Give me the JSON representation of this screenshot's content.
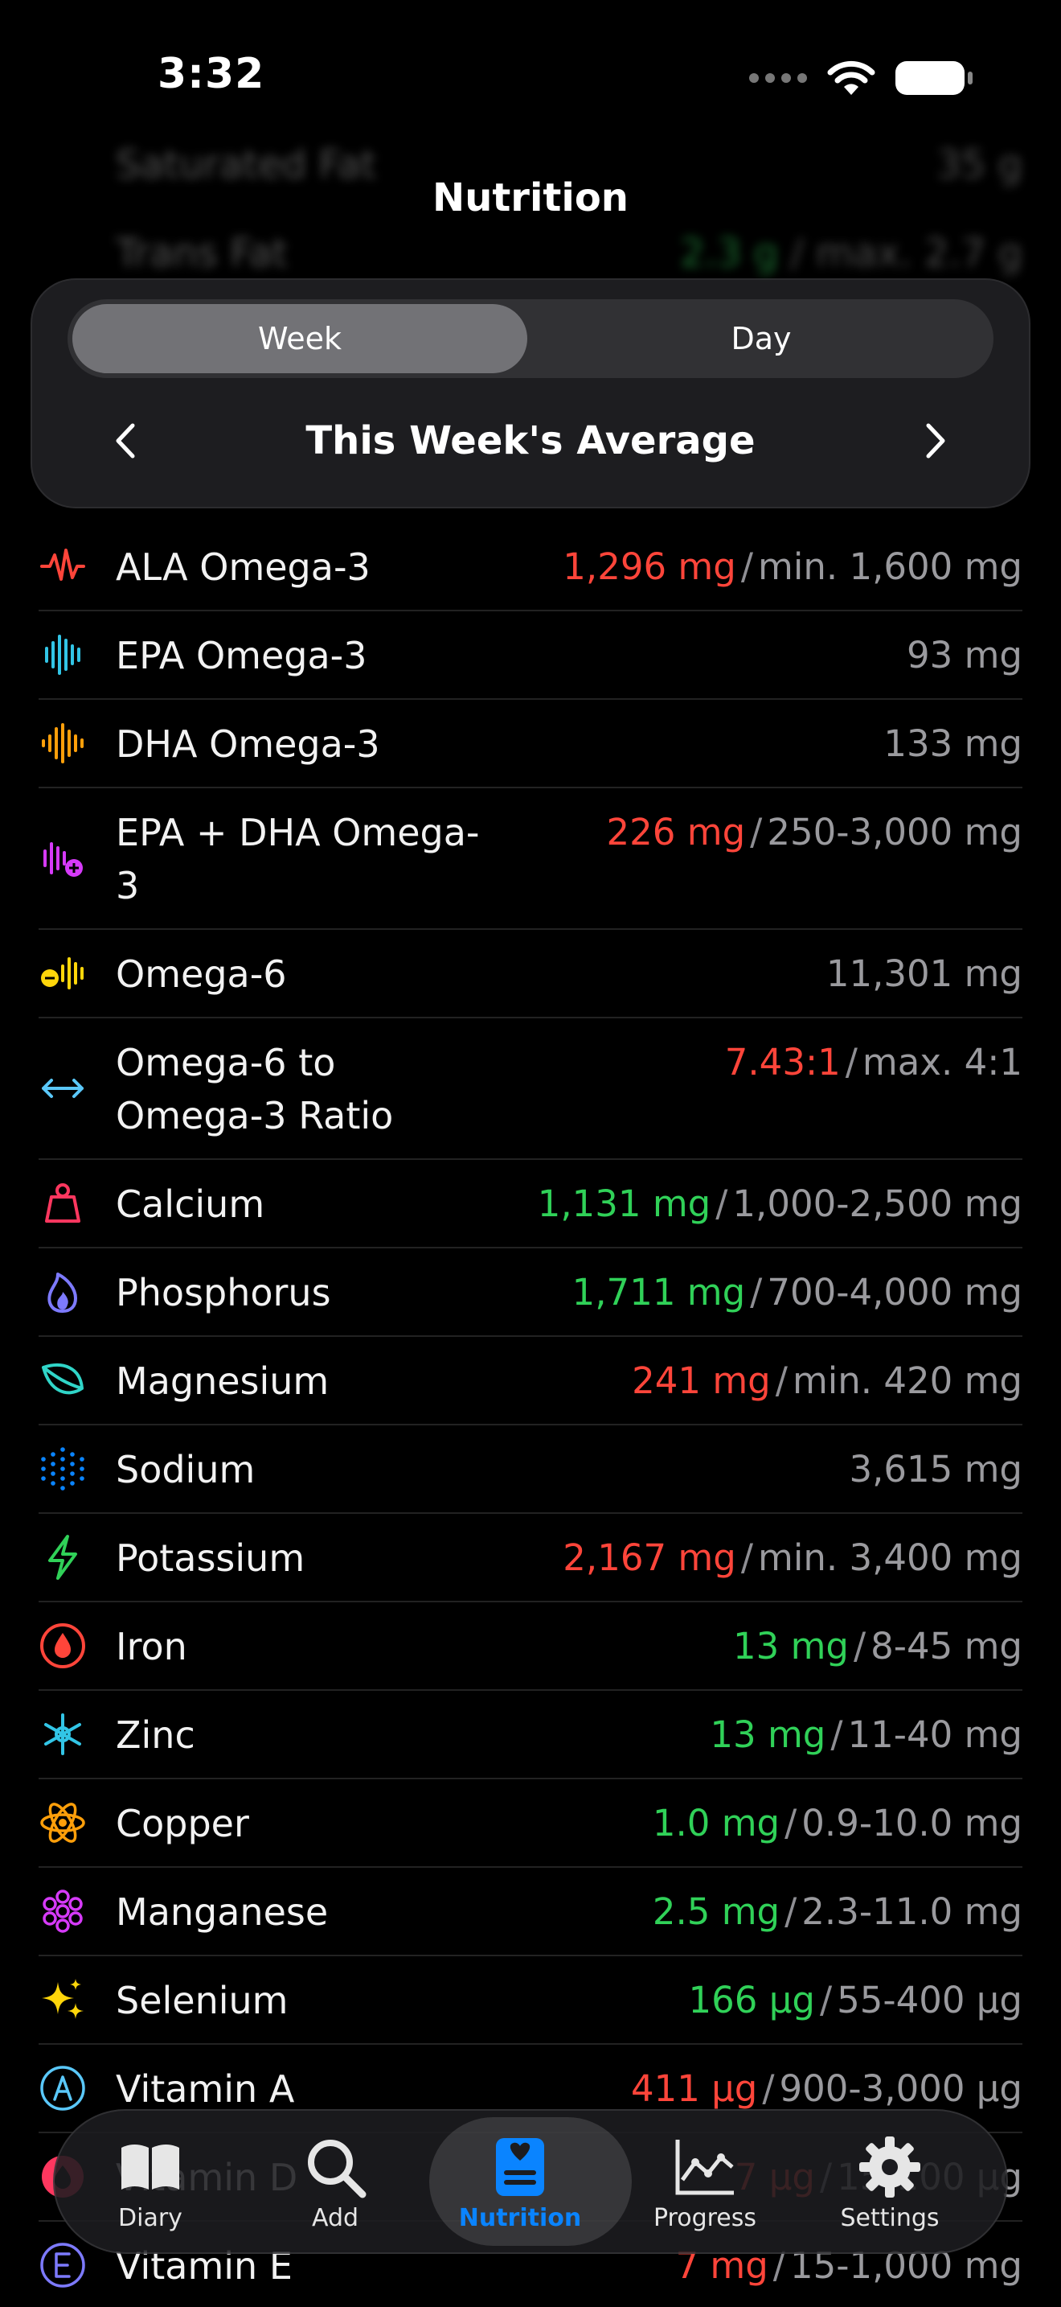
{
  "status_bar": {
    "time": "3:32"
  },
  "title": "Nutrition",
  "segmented_control": {
    "week_label": "Week",
    "day_label": "Day",
    "selected": "Week"
  },
  "period_label": "This Week's Average",
  "ghost_rows": [
    {
      "name": "Saturated Fat",
      "value": "35 g"
    },
    {
      "name": "Trans Fat",
      "value_amount": "2.3 g",
      "value_target": "max. 2.7 g"
    }
  ],
  "nutrients": [
    {
      "name": "ALA Omega-3",
      "amount": "1,296 mg",
      "status": "red",
      "target": "min. 1,600 mg",
      "icon": "ala-waveform-icon",
      "color": "#ff453a"
    },
    {
      "name": "EPA Omega-3",
      "amount": "93 mg",
      "status": "neutral",
      "target": "",
      "icon": "epa-waveform-icon",
      "color": "#32c5e6"
    },
    {
      "name": "DHA Omega-3",
      "amount": "133 mg",
      "status": "neutral",
      "target": "",
      "icon": "dha-waveform-icon",
      "color": "#ff9f0a"
    },
    {
      "name": "EPA + DHA Omega-3",
      "amount": "226 mg",
      "status": "red",
      "target": "250-3,000 mg",
      "icon": "epa-dha-waveform-plus-icon",
      "color": "#d63af9"
    },
    {
      "name": "Omega-6",
      "amount": "11,301 mg",
      "status": "neutral",
      "target": "",
      "icon": "omega6-waveform-minus-icon",
      "color": "#ffd60a"
    },
    {
      "name": "Omega-6 to Omega-3 Ratio",
      "amount": "7.43:1",
      "status": "red",
      "target": "max. 4:1",
      "icon": "left-right-arrow-icon",
      "color": "#5ac8fa"
    },
    {
      "name": "Calcium",
      "amount": "1,131 mg",
      "status": "green",
      "target": "1,000-2,500 mg",
      "icon": "weight-icon",
      "color": "#ff375f"
    },
    {
      "name": "Phosphorus",
      "amount": "1,711 mg",
      "status": "green",
      "target": "700-4,000 mg",
      "icon": "flame-icon",
      "color": "#7d7aff"
    },
    {
      "name": "Magnesium",
      "amount": "241 mg",
      "status": "red",
      "target": "min. 420 mg",
      "icon": "leaf-icon",
      "color": "#30d5c8"
    },
    {
      "name": "Sodium",
      "amount": "3,615 mg",
      "status": "neutral",
      "target": "",
      "icon": "dots-circle-icon",
      "color": "#0a84ff"
    },
    {
      "name": "Potassium",
      "amount": "2,167 mg",
      "status": "red",
      "target": "min. 3,400 mg",
      "icon": "bolt-icon",
      "color": "#30d158"
    },
    {
      "name": "Iron",
      "amount": "13 mg",
      "status": "green",
      "target": "8-45 mg",
      "icon": "drop-circle-icon",
      "color": "#ff453a"
    },
    {
      "name": "Zinc",
      "amount": "13 mg",
      "status": "green",
      "target": "11-40 mg",
      "icon": "snowflake-asterisk-icon",
      "color": "#32c5e6"
    },
    {
      "name": "Copper",
      "amount": "1.0 mg",
      "status": "green",
      "target": "0.9-10.0 mg",
      "icon": "atom-icon",
      "color": "#ff9f0a"
    },
    {
      "name": "Manganese",
      "amount": "2.5 mg",
      "status": "green",
      "target": "2.3-11.0 mg",
      "icon": "hexagon-cluster-icon",
      "color": "#d63af9"
    },
    {
      "name": "Selenium",
      "amount": "166 µg",
      "status": "green",
      "target": "55-400 µg",
      "icon": "sparkles-icon",
      "color": "#ffd60a"
    },
    {
      "name": "Vitamin A",
      "amount": "411 µg",
      "status": "red",
      "target": "900-3,000 µg",
      "icon": "circle-a-icon",
      "color": "#5ac8fa"
    },
    {
      "name": "Vitamin D",
      "amount": "7 µg",
      "status": "red",
      "target": "15-100 µg",
      "icon": "circle-d-icon",
      "color": "#ff375f"
    },
    {
      "name": "Vitamin E",
      "amount": "7 mg",
      "status": "red",
      "target": "15-1,000 mg",
      "icon": "circle-e-icon",
      "color": "#7d7aff"
    }
  ],
  "tab_bar": {
    "tabs": [
      {
        "label": "Diary",
        "icon": "book-icon"
      },
      {
        "label": "Add",
        "icon": "magnifier-icon"
      },
      {
        "label": "Nutrition",
        "icon": "nutrition-label-icon"
      },
      {
        "label": "Progress",
        "icon": "chart-line-icon"
      },
      {
        "label": "Settings",
        "icon": "gear-icon"
      }
    ],
    "active": "Nutrition"
  },
  "colors": {
    "accent": "#0a84ff",
    "red": "#ff453a",
    "green": "#30d158",
    "secondary_text": "#9a9a9e"
  }
}
